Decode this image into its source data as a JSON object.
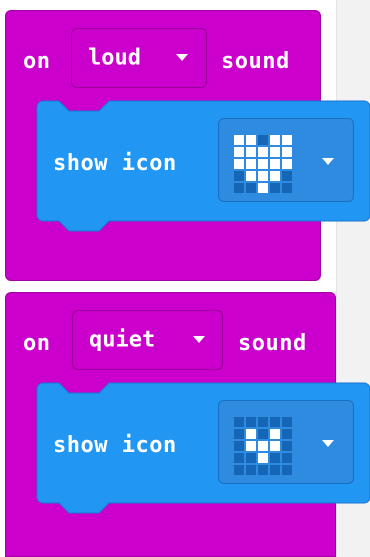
{
  "blocks": [
    {
      "event_prefix": "on",
      "event_value": "loud",
      "event_suffix": "sound",
      "statement_label": "show icon",
      "icon_leds": [
        [
          1,
          1,
          0,
          1,
          1
        ],
        [
          1,
          1,
          1,
          1,
          1
        ],
        [
          1,
          1,
          1,
          1,
          1
        ],
        [
          0,
          1,
          1,
          1,
          0
        ],
        [
          0,
          0,
          1,
          0,
          0
        ]
      ]
    },
    {
      "event_prefix": "on",
      "event_value": "quiet",
      "event_suffix": "sound",
      "statement_label": "show icon",
      "icon_leds": [
        [
          0,
          0,
          0,
          0,
          0
        ],
        [
          0,
          1,
          0,
          1,
          0
        ],
        [
          0,
          1,
          1,
          1,
          0
        ],
        [
          0,
          0,
          1,
          0,
          0
        ],
        [
          0,
          0,
          0,
          0,
          0
        ]
      ]
    }
  ],
  "colors": {
    "event_block": "#cc00cc",
    "statement_block": "#2196f3",
    "led_on": "#ffffff",
    "led_off": "#1566b7"
  },
  "icons": {
    "dropdown_caret": "caret-down-icon"
  }
}
